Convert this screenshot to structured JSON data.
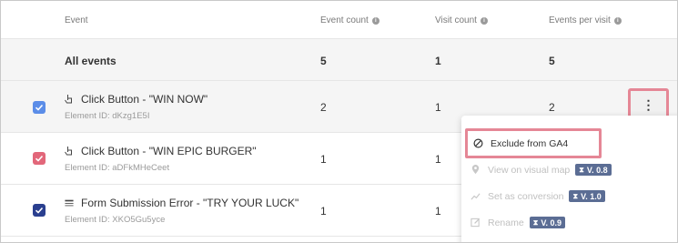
{
  "columns": {
    "event": "Event",
    "event_count": "Event count",
    "visit_count": "Visit count",
    "events_per_visit": "Events per visit"
  },
  "all_events": {
    "label": "All events",
    "event_count": "5",
    "visit_count": "1",
    "events_per_visit": "5"
  },
  "rows": [
    {
      "name": "Click Button - \"WIN NOW\"",
      "element_id": "Element ID: dKzg1E5I",
      "event_count": "2",
      "visit_count": "1",
      "events_per_visit": "2",
      "icon": "hand-pointer-icon",
      "checkbox_color": "#5b8de8"
    },
    {
      "name": "Click Button - \"WIN EPIC BURGER\"",
      "element_id": "Element ID: aDFkMHeCeet",
      "event_count": "1",
      "visit_count": "1",
      "icon": "hand-pointer-icon",
      "checkbox_color": "#e2677a"
    },
    {
      "name": "Form Submission Error - \"TRY YOUR LUCK\"",
      "element_id": "Element ID: XKO5Gu5yce",
      "event_count": "1",
      "visit_count": "1",
      "icon": "form-icon",
      "checkbox_color": "#2a3f8f"
    }
  ],
  "menu": {
    "items": [
      {
        "label": "Exclude from GA4",
        "icon": "block-icon",
        "enabled": true
      },
      {
        "label": "View on visual map",
        "icon": "map-pin-icon",
        "enabled": false,
        "badge": "V. 0.8"
      },
      {
        "label": "Set as conversion",
        "icon": "trend-icon",
        "enabled": false,
        "badge": "V. 1.0"
      },
      {
        "label": "Rename",
        "icon": "edit-icon",
        "enabled": false,
        "badge": "V. 0.9"
      }
    ]
  },
  "colors": {
    "highlight": "#e58796",
    "badge_bg": "#5b6d94"
  }
}
